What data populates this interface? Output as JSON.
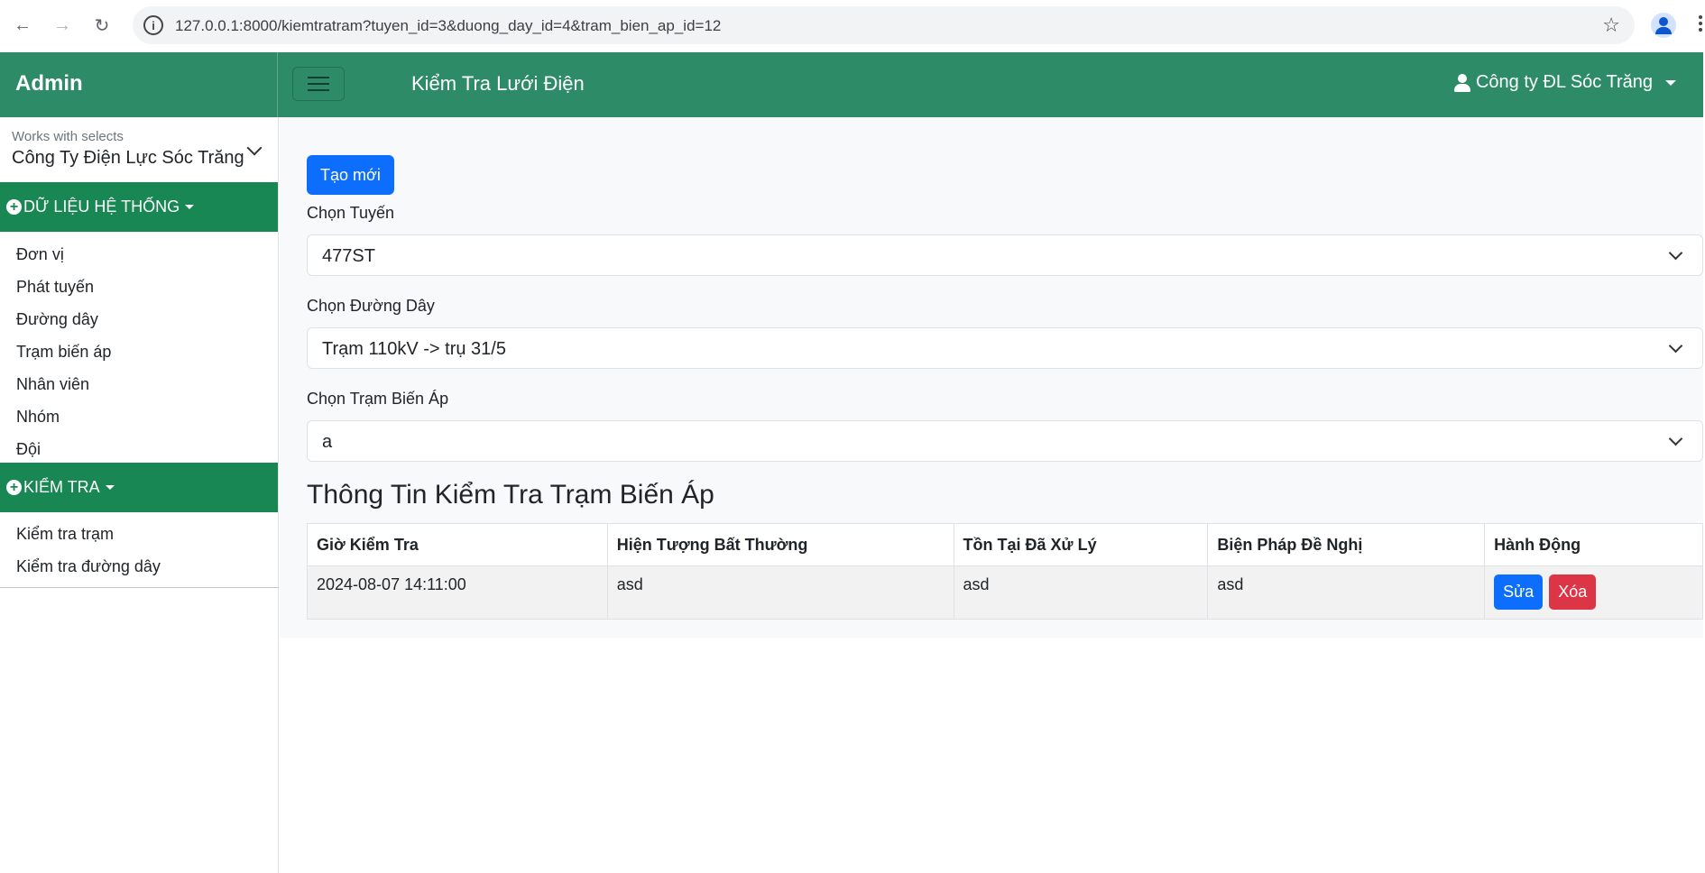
{
  "browser": {
    "url": "127.0.0.1:8000/kiemtratram?tuyen_id=3&duong_day_id=4&tram_bien_ap_id=12"
  },
  "topbar": {
    "brand": "Admin",
    "title": "Kiểm Tra Lưới Điện",
    "user": "Công ty ĐL Sóc Trăng"
  },
  "sidebar": {
    "select_hint": "Works with selects",
    "select_value": "Công Ty Điện Lực Sóc Trăng",
    "section1_label": "DỮ LIỆU HỆ THỐNG",
    "section1_items": [
      "Đơn vị",
      "Phát tuyến",
      "Đường dây",
      "Trạm biến áp",
      "Nhân viên",
      "Nhóm",
      "Đội"
    ],
    "section2_label": "KIỂM TRA",
    "section2_items": [
      "Kiểm tra trạm",
      "Kiểm tra đường dây"
    ]
  },
  "main": {
    "create_button": "Tạo mới",
    "tuyen_label": "Chọn Tuyến",
    "tuyen_value": "477ST",
    "duong_day_label": "Chọn Đường Dây",
    "duong_day_value": "Trạm 110kV -> trụ 31/5",
    "tram_label": "Chọn Trạm Biến Áp",
    "tram_value": "a",
    "section_title": "Thông Tin Kiểm Tra Trạm Biến Áp",
    "table": {
      "headers": [
        "Giờ Kiểm Tra",
        "Hiện Tượng Bất Thường",
        "Tồn Tại Đã Xử Lý",
        "Biện Pháp Đề Nghị",
        "Hành Động"
      ],
      "rows": [
        {
          "time": "2024-08-07 14:11:00",
          "phenomenon": "asd",
          "handled": "asd",
          "proposal": "asd"
        }
      ],
      "edit_label": "Sửa",
      "delete_label": "Xóa"
    }
  },
  "colors": {
    "topbar": "#2e8b68",
    "sidebar_section": "#198754",
    "primary": "#0d6efd",
    "danger": "#dc3545"
  }
}
